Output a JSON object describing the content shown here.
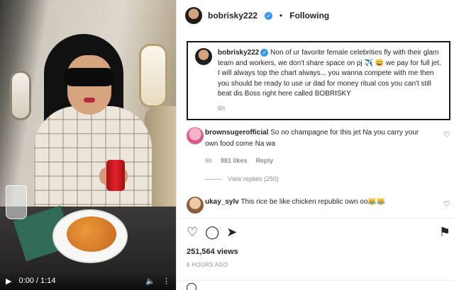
{
  "video": {
    "play_icon": "play-icon",
    "time": "0:00 / 1:14",
    "volume_icon": "volume-icon",
    "more_icon": "more-vertical-icon"
  },
  "header": {
    "username": "bobrisky222",
    "separator": "•",
    "follow_status": "Following"
  },
  "caption": {
    "username": "bobrisky222",
    "text": "Non of ur favorite female celebrities fly with their glam team and workers, we don't share space on pj ✈️ 😄 we pay for full jet. I will always top the chart always... you wanna compete with me then you should be ready to use ur dad for money ritual cos you can't still beat dis Boss right here called BOBRISKY",
    "time": "6h"
  },
  "comments": [
    {
      "username": "brownsugerofficial",
      "text": "So no champagne for this jet Na you carry your own food come Na wa",
      "time": "6h",
      "likes": "981 likes",
      "reply_label": "Reply",
      "view_replies": "View replies (250)"
    },
    {
      "username": "ukay_sylv",
      "text": "This rice be like chicken republic own oo😹😹"
    }
  ],
  "actions": {
    "icons": [
      "heart-icon",
      "comment-icon",
      "share-icon",
      "bookmark-icon"
    ]
  },
  "stats": {
    "views": "251,564 views",
    "posted": "6 HOURS AGO"
  }
}
